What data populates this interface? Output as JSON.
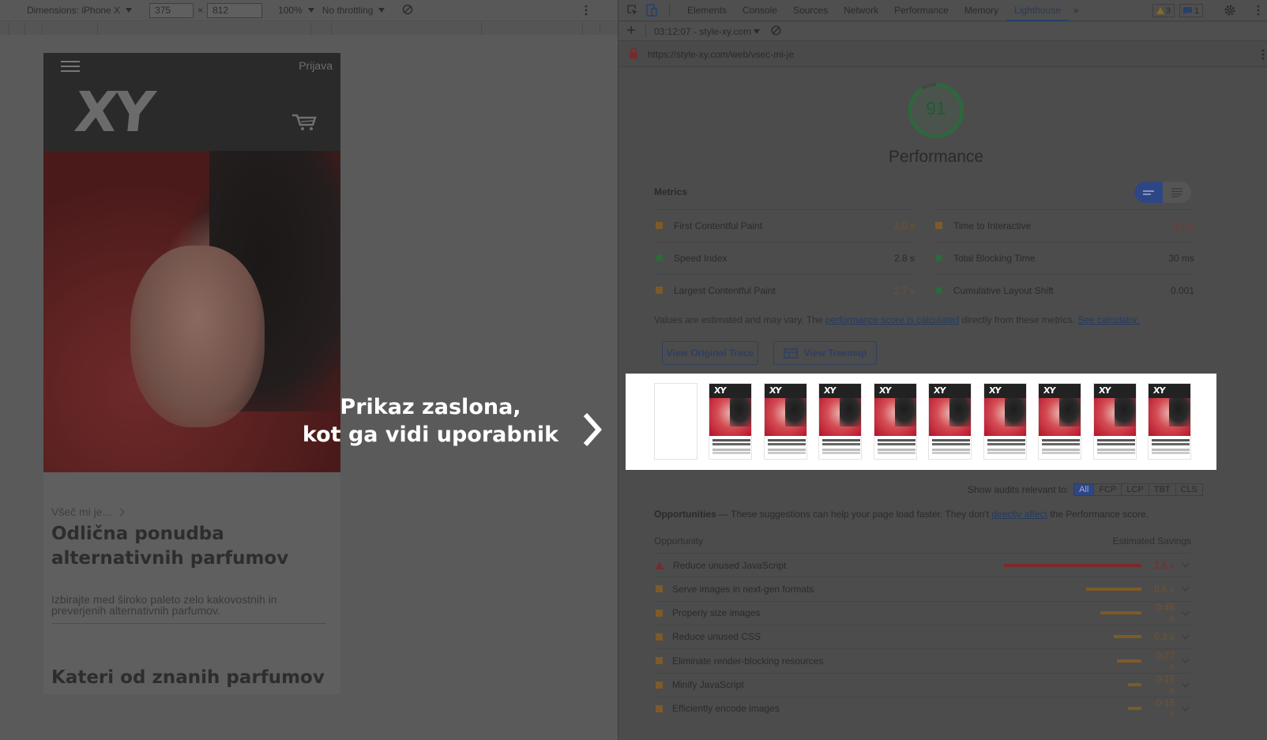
{
  "device_toolbar": {
    "dimensions_label": "Dimensions: iPhone X",
    "width": "375",
    "height": "812",
    "times": "×",
    "zoom": "100%",
    "throttling": "No throttling"
  },
  "site": {
    "login": "Prijava",
    "logo": "XY",
    "breadcrumb": "Všeč mi je...",
    "heading": "Odlična ponudba alternativnih parfumov",
    "description": "Izbirajte med široko paleto zelo kakovostnih in preverjenih alternativnih parfumov.",
    "heading_2": "Kateri od znanih parfumov"
  },
  "overlay": {
    "line1": "Prikaz zaslona,",
    "line2": "kot ga vidi uporabnik"
  },
  "devtools": {
    "tabs": [
      {
        "label": "Elements"
      },
      {
        "label": "Console"
      },
      {
        "label": "Sources"
      },
      {
        "label": "Network"
      },
      {
        "label": "Performance"
      },
      {
        "label": "Memory"
      },
      {
        "label": "Lighthouse",
        "active": true
      }
    ],
    "more_tabs": "»",
    "warnings_count": "3",
    "messages_count": "1",
    "report_selector": "03:12:07 - style-xy.com",
    "url": "https://style-xy.com/web/vsec-mi-je"
  },
  "report": {
    "score": "91",
    "category": "Performance",
    "metrics_title": "Metrics",
    "metrics": [
      {
        "name": "First Contentful Paint",
        "value": "2.0 s",
        "rating": "average"
      },
      {
        "name": "Time to Interactive",
        "value": "6.5 s",
        "rating": "fail"
      },
      {
        "name": "Speed Index",
        "value": "2.8 s",
        "rating": "pass"
      },
      {
        "name": "Total Blocking Time",
        "value": "30 ms",
        "rating": "pass"
      },
      {
        "name": "Largest Contentful Paint",
        "value": "2.7 s",
        "rating": "average"
      },
      {
        "name": "Cumulative Layout Shift",
        "value": "0.001",
        "rating": "pass"
      }
    ],
    "note_pre": "Values are estimated and may vary. The ",
    "note_link1": "performance score is calculated",
    "note_mid": " directly from these metrics. ",
    "note_link2": "See calculator.",
    "btn_trace": "View Original Trace",
    "btn_treemap": "View Treemap",
    "filter_label": "Show audits relevant to:",
    "filters": [
      "All",
      "FCP",
      "LCP",
      "TBT",
      "CLS"
    ],
    "opp_title": "Opportunities",
    "opp_desc_pre": " — These suggestions can help your page load faster. They don't ",
    "opp_desc_link": "directly affect",
    "opp_desc_post": " the Performance score.",
    "opp_col_left": "Opportunity",
    "opp_col_right": "Estimated Savings",
    "opportunities": [
      {
        "name": "Reduce unused JavaScript",
        "savings": "1.5 s",
        "seconds": 1.5,
        "severity": "fail"
      },
      {
        "name": "Serve images in next-gen formats",
        "savings": "0.6 s",
        "seconds": 0.6,
        "severity": "average"
      },
      {
        "name": "Properly size images",
        "savings": "0.45 s",
        "seconds": 0.45,
        "severity": "average"
      },
      {
        "name": "Reduce unused CSS",
        "savings": "0.3 s",
        "seconds": 0.3,
        "severity": "average"
      },
      {
        "name": "Eliminate render-blocking resources",
        "savings": "0.27 s",
        "seconds": 0.27,
        "severity": "average"
      },
      {
        "name": "Minify JavaScript",
        "savings": "0.15 s",
        "seconds": 0.15,
        "severity": "average"
      },
      {
        "name": "Efficiently encode images",
        "savings": "0.15 s",
        "seconds": 0.15,
        "severity": "average"
      }
    ]
  },
  "colors": {
    "pass": "#2a6b3c",
    "average": "#7d5a2a",
    "fail": "#7a2a2a",
    "accent": "#2e4683"
  }
}
